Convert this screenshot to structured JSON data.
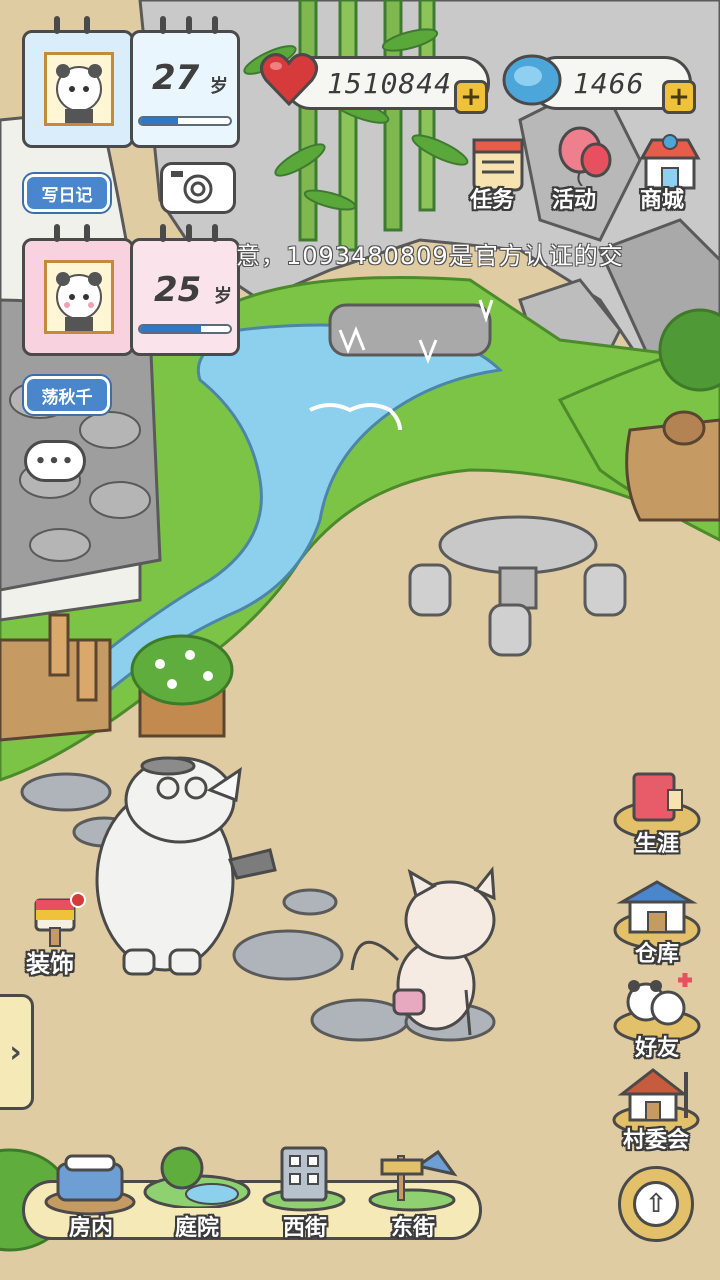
{
  "characters": [
    {
      "age": "27",
      "unit": "岁",
      "progress": 0.42,
      "action_label": "写日记"
    },
    {
      "age": "25",
      "unit": "岁",
      "progress": 0.68,
      "action_label": "荡秋千"
    }
  ],
  "resources": {
    "hearts": "1510844",
    "clovers": "1466",
    "plus_symbol": "+"
  },
  "top_menu": {
    "tasks": "任务",
    "events": "活动",
    "shop": "商城"
  },
  "ticker_text": "意，1093480809是官方认证的交",
  "chat_bubble": "•••",
  "side_menu": {
    "career": "生涯",
    "warehouse": "仓库",
    "friends": "好友",
    "village_committee": "村委会"
  },
  "decorate_label": "装饰",
  "expand_arrow": "›",
  "upgrade_arrow": "⇧",
  "bottom_nav": {
    "home": "房内",
    "yard": "庭院",
    "west_street": "西街",
    "east_street": "东街"
  },
  "colors": {
    "sand": "#e0cca3",
    "grass": "#7bc446",
    "water": "#8dd0ee",
    "cliff": "#c9c9c9",
    "card_blue": "#d9eefa",
    "card_pink": "#f8d3df",
    "pill_blue": "#4a86cc",
    "nav_bar": "#f6e9b8"
  }
}
